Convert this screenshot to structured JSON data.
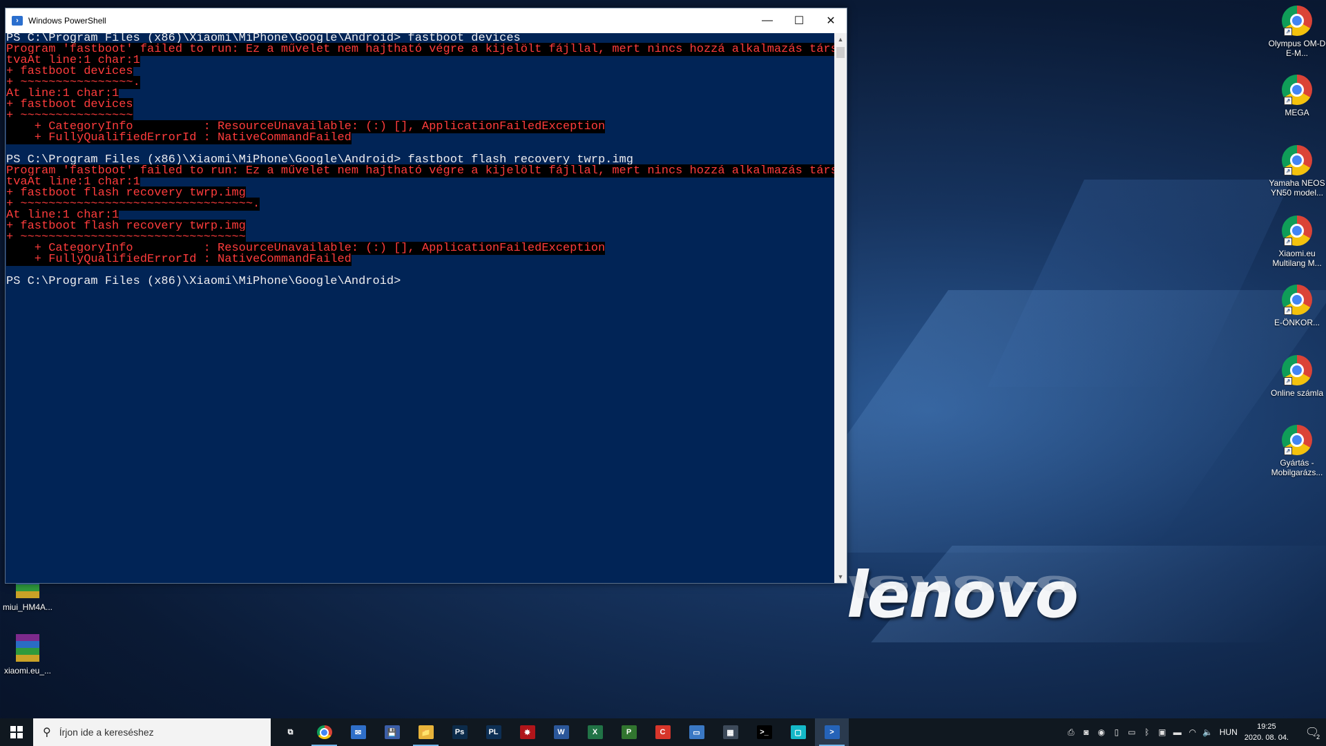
{
  "window": {
    "title": "Windows PowerShell",
    "minimize": "—",
    "maximize": "☐",
    "close": "✕"
  },
  "console": {
    "lines": [
      {
        "kind": "norm",
        "text": "PS C:\\Program Files (x86)\\Xiaomi\\MiPhone\\Google\\Android> fastboot devices"
      },
      {
        "kind": "err",
        "text": "Program 'fastboot' failed to run: Ez a művelet nem hajtható végre a kijelölt fájllal, mert nincs hozzá alkalmazás társí"
      },
      {
        "kind": "err",
        "text": "tvaAt line:1 char:1"
      },
      {
        "kind": "err",
        "text": "+ fastboot devices"
      },
      {
        "kind": "err",
        "text": "+ ~~~~~~~~~~~~~~~~."
      },
      {
        "kind": "err",
        "text": "At line:1 char:1"
      },
      {
        "kind": "err",
        "text": "+ fastboot devices"
      },
      {
        "kind": "err",
        "text": "+ ~~~~~~~~~~~~~~~~"
      },
      {
        "kind": "err",
        "text": "    + CategoryInfo          : ResourceUnavailable: (:) [], ApplicationFailedException"
      },
      {
        "kind": "err",
        "text": "    + FullyQualifiedErrorId : NativeCommandFailed"
      },
      {
        "kind": "blank",
        "text": ""
      },
      {
        "kind": "norm",
        "text": "PS C:\\Program Files (x86)\\Xiaomi\\MiPhone\\Google\\Android> fastboot flash recovery twrp.img"
      },
      {
        "kind": "err",
        "text": "Program 'fastboot' failed to run: Ez a művelet nem hajtható végre a kijelölt fájllal, mert nincs hozzá alkalmazás társí"
      },
      {
        "kind": "err",
        "text": "tvaAt line:1 char:1"
      },
      {
        "kind": "err",
        "text": "+ fastboot flash recovery twrp.img"
      },
      {
        "kind": "err",
        "text": "+ ~~~~~~~~~~~~~~~~~~~~~~~~~~~~~~~~~."
      },
      {
        "kind": "err",
        "text": "At line:1 char:1"
      },
      {
        "kind": "err",
        "text": "+ fastboot flash recovery twrp.img"
      },
      {
        "kind": "err",
        "text": "+ ~~~~~~~~~~~~~~~~~~~~~~~~~~~~~~~~"
      },
      {
        "kind": "err",
        "text": "    + CategoryInfo          : ResourceUnavailable: (:) [], ApplicationFailedException"
      },
      {
        "kind": "err",
        "text": "    + FullyQualifiedErrorId : NativeCommandFailed"
      },
      {
        "kind": "blank",
        "text": ""
      },
      {
        "kind": "norm",
        "text": "PS C:\\Program Files (x86)\\Xiaomi\\MiPhone\\Google\\Android>"
      }
    ]
  },
  "desktop": {
    "right_icons": [
      {
        "label": "Olympus OM-D E-M...",
        "icon": "chrome-icon"
      },
      {
        "label": "MEGA",
        "icon": "chrome-icon"
      },
      {
        "label": "Yamaha NEOS YN50 model...",
        "icon": "chrome-icon"
      },
      {
        "label": "Xiaomi.eu Multilang M...",
        "icon": "chrome-icon"
      },
      {
        "label": "E-ÖNKOR...",
        "icon": "chrome-icon"
      },
      {
        "label": "Online számla",
        "icon": "chrome-icon"
      },
      {
        "label": "Gyártás - Mobilgarázs...",
        "icon": "chrome-icon"
      }
    ],
    "left_icons": [
      {
        "label": "miui_HM4A...",
        "icon": "winrar-icon"
      },
      {
        "label": "xiaomi.eu_...",
        "icon": "winrar-icon"
      }
    ],
    "brand": "lenovo"
  },
  "taskbar": {
    "search_placeholder": "Írjon ide a kereséshez",
    "apps": [
      {
        "name": "task-view",
        "glyph": "⧉",
        "color": "#101820"
      },
      {
        "name": "chrome",
        "glyph": "",
        "color": "#101820"
      },
      {
        "name": "thunderbird",
        "glyph": "✉",
        "color": "#2f6fc9"
      },
      {
        "name": "save",
        "glyph": "💾",
        "color": "#3b5ea8"
      },
      {
        "name": "file-explorer",
        "glyph": "📁",
        "color": "#e8b33a"
      },
      {
        "name": "photoshop",
        "glyph": "Ps",
        "color": "#0c2b4a"
      },
      {
        "name": "pl",
        "glyph": "PL",
        "color": "#0d2f54"
      },
      {
        "name": "red-app",
        "glyph": "✸",
        "color": "#b0151a"
      },
      {
        "name": "word",
        "glyph": "W",
        "color": "#2b579a"
      },
      {
        "name": "excel",
        "glyph": "X",
        "color": "#217346"
      },
      {
        "name": "project",
        "glyph": "P",
        "color": "#31752f"
      },
      {
        "name": "ccleaner",
        "glyph": "C",
        "color": "#d8362b"
      },
      {
        "name": "remote-desktop",
        "glyph": "▭",
        "color": "#3a78c4"
      },
      {
        "name": "calculator",
        "glyph": "▦",
        "color": "#3d4a5a"
      },
      {
        "name": "cmd",
        "glyph": ">_",
        "color": "#000000"
      },
      {
        "name": "cyan-app",
        "glyph": "▢",
        "color": "#14b8c8"
      },
      {
        "name": "powershell",
        "glyph": ">",
        "color": "#2563b8"
      }
    ],
    "tray": {
      "language": "HUN",
      "time": "19:25",
      "date": "2020. 08. 04.",
      "notifications": "2"
    }
  }
}
